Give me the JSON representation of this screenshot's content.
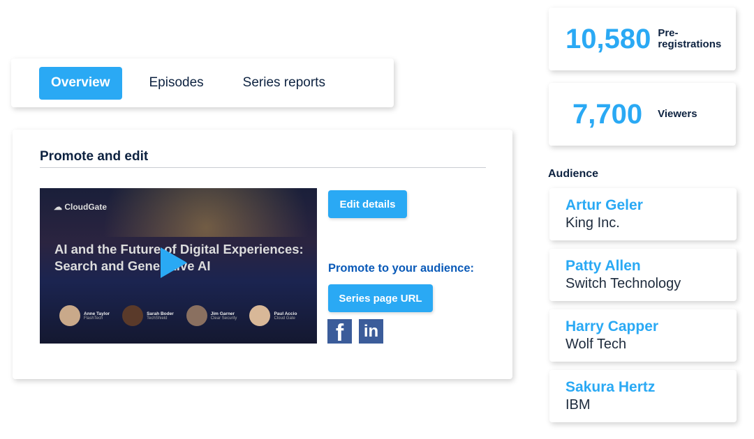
{
  "tabs": [
    {
      "label": "Overview"
    },
    {
      "label": "Episodes"
    },
    {
      "label": "Series reports"
    }
  ],
  "promote": {
    "title": "Promote and edit",
    "edit_label": "Edit details",
    "audience_label": "Promote to your audience:",
    "series_url_label": "Series page URL"
  },
  "video": {
    "brand": "CloudGate",
    "title": "AI and the Future of Digital Experiences: Search and Generative AI",
    "speakers": [
      {
        "name": "Anne Taylor",
        "company": "FlashTech"
      },
      {
        "name": "Sarah Boder",
        "company": "TechShield"
      },
      {
        "name": "Jim Garner",
        "company": "Clear Security"
      },
      {
        "name": "Paul Accio",
        "company": "Cloud Gate"
      }
    ]
  },
  "stats": [
    {
      "value": "10,580",
      "label": "Pre-registrations"
    },
    {
      "value": "7,700",
      "label": "Viewers"
    }
  ],
  "audience": {
    "title": "Audience",
    "people": [
      {
        "name": "Artur Geler",
        "company": "King Inc."
      },
      {
        "name": "Patty Allen",
        "company": "Switch Technology"
      },
      {
        "name": "Harry Capper",
        "company": "Wolf Tech"
      },
      {
        "name": "Sakura Hertz",
        "company": "IBM"
      }
    ]
  },
  "social": {
    "facebook": "f",
    "linkedin": "in"
  }
}
